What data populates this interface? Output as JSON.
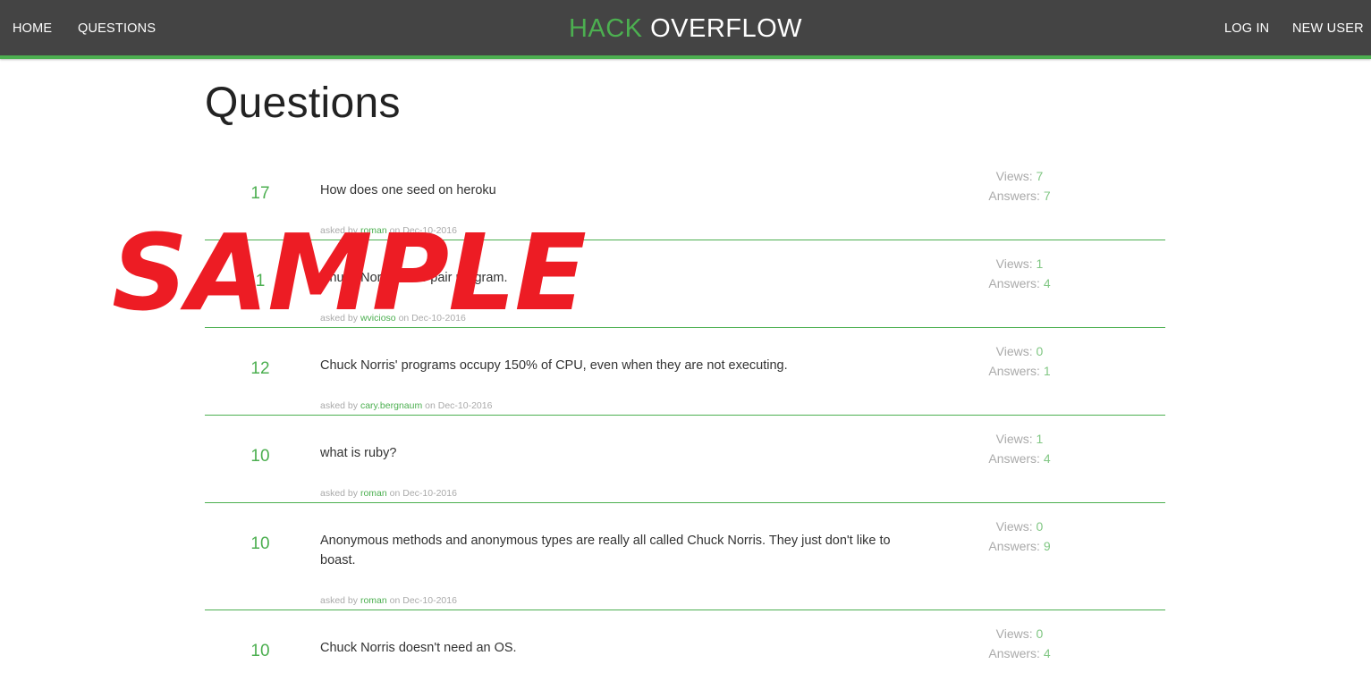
{
  "nav": {
    "home": "HOME",
    "questions": "QUESTIONS",
    "brand_first": "HACK",
    "brand_second": "OVERFLOW",
    "login": "LOG IN",
    "new_user": "NEW USER"
  },
  "page": {
    "title": "Questions"
  },
  "labels": {
    "views": "Views:",
    "answers": "Answers:",
    "asked_by": "asked by",
    "on": "on"
  },
  "questions": [
    {
      "votes": "17",
      "title": "How does one seed on heroku",
      "author": "roman",
      "date": "Dec-10-2016",
      "views": "7",
      "answers": "7"
    },
    {
      "votes": "1",
      "title": "Chuck Norris does pair program.",
      "author": "wvicioso",
      "date": "Dec-10-2016",
      "views": "1",
      "answers": "4"
    },
    {
      "votes": "12",
      "title": "Chuck Norris' programs occupy 150% of CPU, even when they are not executing.",
      "author": "cary.bergnaum",
      "date": "Dec-10-2016",
      "views": "0",
      "answers": "1"
    },
    {
      "votes": "10",
      "title": "what is ruby?",
      "author": "roman",
      "date": "Dec-10-2016",
      "views": "1",
      "answers": "4"
    },
    {
      "votes": "10",
      "title": "Anonymous methods and anonymous types are really all called Chuck Norris. They just don't like to boast.",
      "author": "roman",
      "date": "Dec-10-2016",
      "views": "0",
      "answers": "9"
    },
    {
      "votes": "10",
      "title": "Chuck Norris doesn't need an OS.",
      "author": "",
      "date": "",
      "views": "0",
      "answers": "4"
    }
  ],
  "watermark": "SAMPLE",
  "colors": {
    "accent": "#4caf50",
    "navbar": "#444444",
    "watermark": "#ed1c24"
  }
}
